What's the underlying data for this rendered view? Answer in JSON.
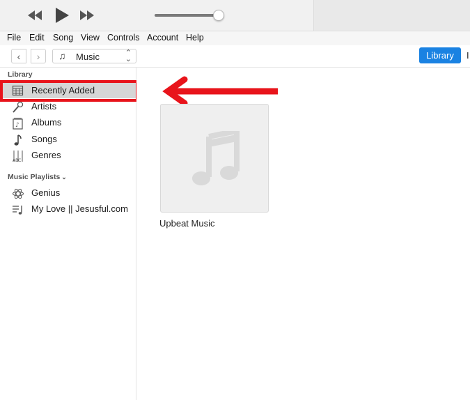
{
  "menu": {
    "items": [
      "File",
      "Edit",
      "Song",
      "View",
      "Controls",
      "Account",
      "Help"
    ]
  },
  "nav": {
    "media_kind": "Music",
    "library_button": "Library",
    "edge_label": "I"
  },
  "sidebar": {
    "library_heading": "Library",
    "library_items": [
      {
        "label": "Recently Added",
        "icon": "grid-icon",
        "selected": true
      },
      {
        "label": "Artists",
        "icon": "microphone-icon"
      },
      {
        "label": "Albums",
        "icon": "album-icon"
      },
      {
        "label": "Songs",
        "icon": "music-note-icon"
      },
      {
        "label": "Genres",
        "icon": "genres-icon"
      }
    ],
    "playlists_heading": "Music Playlists",
    "playlist_items": [
      {
        "label": "Genius",
        "icon": "genius-icon"
      },
      {
        "label": "My Love || Jesusful.com",
        "icon": "playlist-icon"
      }
    ]
  },
  "main": {
    "albums": [
      {
        "title": "Upbeat Music"
      }
    ]
  },
  "annotation": {
    "highlight_color": "#e8141b",
    "accent_color": "#1a82e2"
  }
}
